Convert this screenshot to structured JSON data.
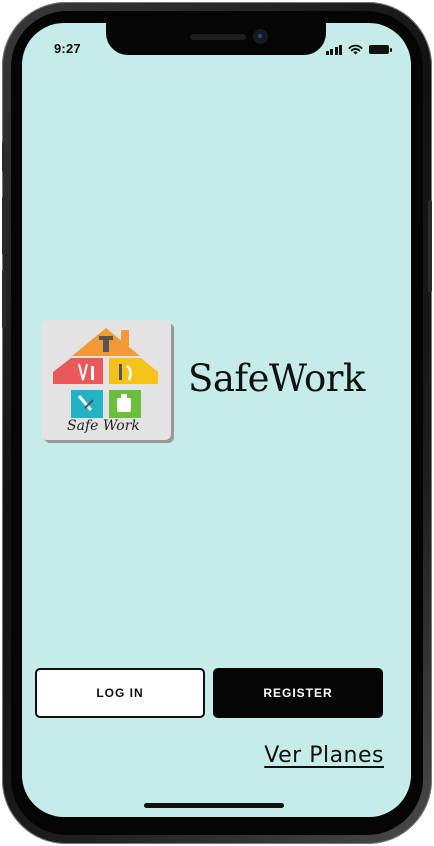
{
  "status_bar": {
    "time": "9:27"
  },
  "brand": {
    "name": "SafeWork",
    "logo_text": "Safe Work"
  },
  "actions": {
    "login_label": "LOG IN",
    "register_label": "REGISTER",
    "plans_link": "Ver Planes"
  },
  "colors": {
    "background": "#c5ece8",
    "primary_button": "#050505",
    "secondary_button": "#ffffff"
  },
  "icons": {
    "signal": "cellular-signal-icon",
    "wifi": "wifi-icon",
    "battery": "battery-icon"
  }
}
